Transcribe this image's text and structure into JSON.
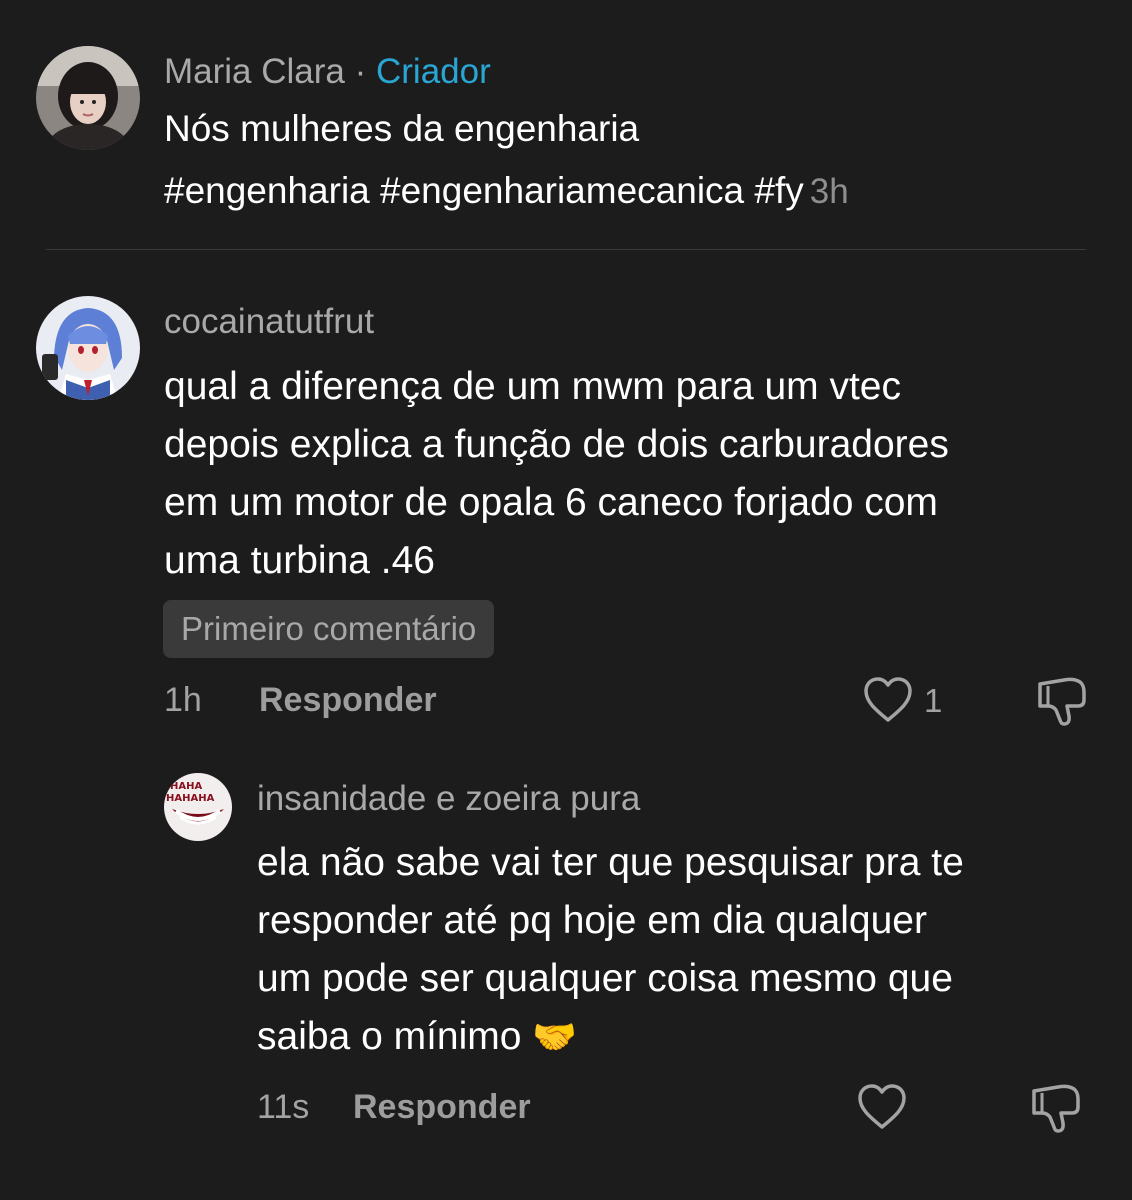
{
  "post": {
    "author": "Maria Clara",
    "separator": " · ",
    "author_badge": "Criador",
    "caption_line1": "Nós mulheres da engenharia",
    "caption_line2": "#engenharia #engenhariamecanica #fy",
    "time": "3h"
  },
  "comments": [
    {
      "username": "cocainatutfrut",
      "lines": [
        "qual a diferença de um mwm para um vtec",
        "depois explica a função de dois carburadores",
        "em um motor de opala 6 caneco forjado com",
        "uma turbina .46"
      ],
      "badge": "Primeiro comentário",
      "time": "1h",
      "reply_label": "Responder",
      "likes": "1",
      "replies": [
        {
          "username": "insanidade e zoeira pura",
          "lines": [
            "ela não sabe vai ter que pesquisar pra te",
            "responder até pq hoje em dia qualquer",
            "um pode ser qualquer coisa mesmo que",
            "saiba o mínimo"
          ],
          "emoji": "🤝",
          "time": "11s",
          "reply_label": "Responder"
        }
      ]
    }
  ],
  "icons": {
    "like": "heart-outline-icon",
    "dislike": "thumbs-down-outline-icon"
  },
  "colors": {
    "background": "#1c1c1c",
    "creator_accent": "#2aa6d4",
    "muted_text": "#a9a9a9"
  }
}
